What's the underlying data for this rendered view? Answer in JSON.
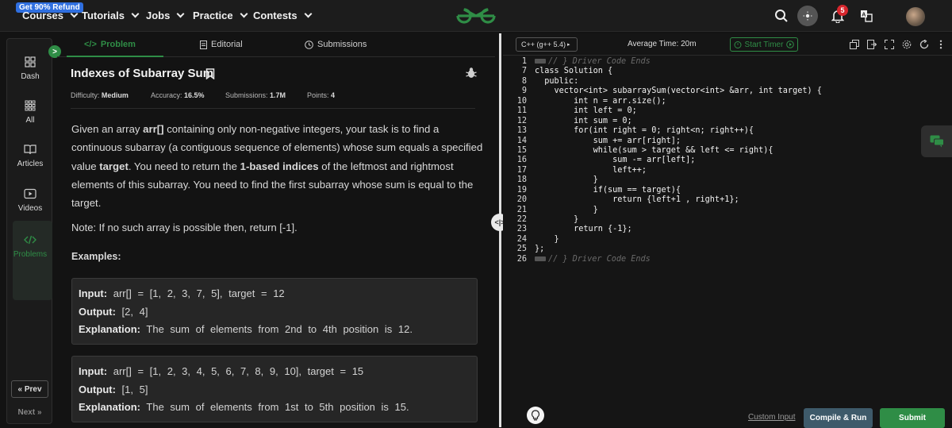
{
  "topbar": {
    "refund_badge": "Get 90% Refund",
    "nav": [
      "Courses",
      "Tutorials",
      "Jobs",
      "Practice",
      "Contests"
    ],
    "notification_count": "5",
    "accent": "#2f8d46"
  },
  "sidebar": {
    "items": [
      {
        "label": "Dash",
        "icon": "dashboard-icon"
      },
      {
        "label": "All",
        "icon": "grid-icon"
      },
      {
        "label": "Articles",
        "icon": "book-icon"
      },
      {
        "label": "Videos",
        "icon": "video-icon"
      },
      {
        "label": "Problems",
        "icon": "code-icon"
      }
    ],
    "prev": "« Prev",
    "next": "Next »"
  },
  "tabs": {
    "problem": "Problem",
    "editorial": "Editorial",
    "submissions": "Submissions"
  },
  "problem": {
    "title": "Indexes of Subarray Sum",
    "meta": {
      "difficulty_label": "Difficulty:",
      "difficulty": "Medium",
      "accuracy_label": "Accuracy:",
      "accuracy": "16.5%",
      "submissions_label": "Submissions:",
      "submissions": "1.7M",
      "points_label": "Points:",
      "points": "4"
    },
    "desc": {
      "p1": "Given an array ",
      "arr": "arr[]",
      "p2": " containing only non-negative integers, your task is to find a continuous subarray (a contiguous sequence of elements) whose sum equals a specified value ",
      "target": "target",
      "p3": ". You need to return the ",
      "bold_idx": "1-based indices",
      "p4": " of the leftmost and rightmost elements of this subarray. You need to find the first subarray whose sum is equal to the target."
    },
    "note": "Note: If no such array is possible then, return [-1].",
    "examples_heading": "Examples:",
    "examples": [
      {
        "input_label": "Input:",
        "input": "arr[] = [1, 2, 3, 7, 5], target = 12",
        "output_label": "Output:",
        "output": "[2, 4]",
        "explanation_label": "Explanation:",
        "explanation": "The sum of elements from 2nd to 4th position is 12."
      },
      {
        "input_label": "Input:",
        "input": "arr[] = [1, 2, 3, 4, 5, 6, 7, 8, 9, 10], target = 15",
        "output_label": "Output:",
        "output": "[1, 5]",
        "explanation_label": "Explanation:",
        "explanation": "The sum of elements from 1st to 5th position is 15."
      }
    ]
  },
  "editor": {
    "language": "C++ (g++ 5.4)",
    "average_time": "Average Time: 20m",
    "start_timer": "Start Timer",
    "code_lines": [
      {
        "n": "1",
        "t": "// } Driver Code Ends",
        "c": true
      },
      {
        "n": "7",
        "t": "class Solution {"
      },
      {
        "n": "8",
        "t": "  public:"
      },
      {
        "n": "9",
        "t": "    vector<int> subarraySum(vector<int> &arr, int target) {"
      },
      {
        "n": "10",
        "t": "        int n = arr.size();"
      },
      {
        "n": "11",
        "t": "        int left = 0;"
      },
      {
        "n": "12",
        "t": "        int sum = 0;"
      },
      {
        "n": "13",
        "t": "        for(int right = 0; right<n; right++){"
      },
      {
        "n": "14",
        "t": "            sum += arr[right];"
      },
      {
        "n": "15",
        "t": "            while(sum > target && left <= right){"
      },
      {
        "n": "16",
        "t": "                sum -= arr[left];"
      },
      {
        "n": "17",
        "t": "                left++;"
      },
      {
        "n": "18",
        "t": "            }"
      },
      {
        "n": "19",
        "t": "            if(sum == target){"
      },
      {
        "n": "20",
        "t": "                return {left+1 , right+1};"
      },
      {
        "n": "21",
        "t": "            }"
      },
      {
        "n": "22",
        "t": "        }"
      },
      {
        "n": "23",
        "t": "        return {-1};"
      },
      {
        "n": "24",
        "t": "    }"
      },
      {
        "n": "25",
        "t": "};"
      },
      {
        "n": "26",
        "t": "// } Driver Code Ends",
        "c": true
      }
    ],
    "custom_input": "Custom Input",
    "compile_run": "Compile & Run",
    "submit": "Submit"
  }
}
